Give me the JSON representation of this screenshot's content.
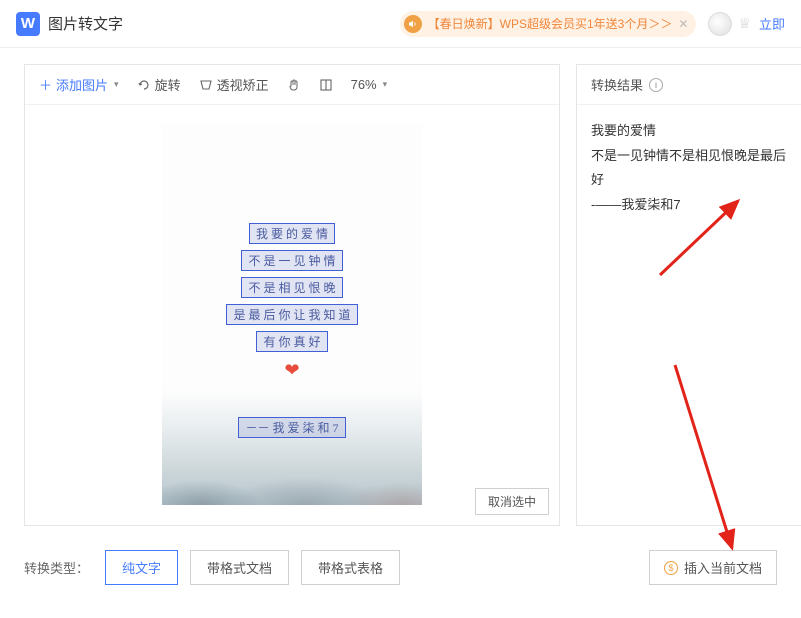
{
  "header": {
    "app_icon_letter": "W",
    "title": "图片转文字",
    "promo_text": "【春日焕新】WPS超级会员买1年送3个月＞＞",
    "login_text": "立即"
  },
  "toolbar": {
    "add_image": "添加图片",
    "rotate": "旋转",
    "perspective": "透视矫正",
    "zoom": "76%"
  },
  "poem": {
    "l1": "我 要 的 爱 情",
    "l2": "不 是 一 见 钟 情",
    "l3": "不 是 相 见 恨 晚",
    "l4": "是 最 后 你 让 我 知 道",
    "l5": "有 你 真 好",
    "sig": "－－ 我 爱 柒 和 7"
  },
  "cancel_selection": "取消选中",
  "result": {
    "header": "转换结果",
    "line1": "我要的爱情",
    "line2": "不是一见钟情不是相见恨晚是最后",
    "line3": "好",
    "line4": "-——我爱柒和7"
  },
  "footer": {
    "label": "转换类型：",
    "pure_text": "纯文字",
    "with_format_doc": "带格式文档",
    "with_format_table": "带格式表格",
    "insert": "插入当前文档"
  }
}
